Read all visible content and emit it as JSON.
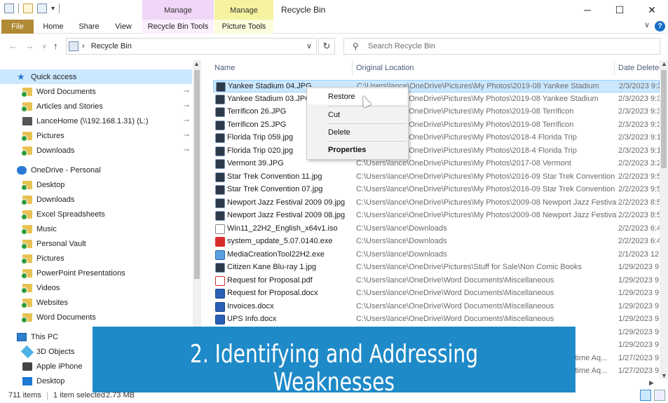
{
  "window": {
    "title": "Recycle Bin",
    "context_tab_group_1": "Manage",
    "context_tab_group_2": "Manage",
    "minimize_glyph": "─",
    "maximize_glyph": "☐",
    "close_glyph": "✕"
  },
  "ribbon": {
    "file": "File",
    "home": "Home",
    "share": "Share",
    "view": "View",
    "recycle_bin_tools": "Recycle Bin Tools",
    "picture_tools": "Picture Tools",
    "help_glyph": "?",
    "chevron_glyph": "∨"
  },
  "address": {
    "back_glyph": "←",
    "forward_glyph": "→",
    "up_glyph": "↑",
    "recent_glyph": "∨",
    "separator": "›",
    "location": "Recycle Bin",
    "dropdown_glyph": "∨",
    "refresh_glyph": "↻"
  },
  "search": {
    "icon_glyph": "⚲",
    "placeholder": "Search Recycle Bin"
  },
  "nav": {
    "items": [
      {
        "label": "Quick access",
        "icon": "star-icon",
        "pinned": false,
        "selected": true
      },
      {
        "label": "Word Documents",
        "icon": "folder-icon",
        "pinned": true
      },
      {
        "label": "Articles and Stories",
        "icon": "folder-icon",
        "pinned": true
      },
      {
        "label": "LanceHome (\\\\192.168.1.31) (L:)",
        "icon": "network-drive-icon",
        "pinned": true
      },
      {
        "label": "Pictures",
        "icon": "folder-icon",
        "pinned": true
      },
      {
        "label": "Downloads",
        "icon": "folder-icon",
        "pinned": true
      },
      {
        "label": "OneDrive - Personal",
        "icon": "cloud-icon",
        "pinned": false
      },
      {
        "label": "Desktop",
        "icon": "folder-icon",
        "pinned": false
      },
      {
        "label": "Downloads",
        "icon": "folder-icon",
        "pinned": false
      },
      {
        "label": "Excel Spreadsheets",
        "icon": "folder-icon",
        "pinned": false
      },
      {
        "label": "Music",
        "icon": "folder-icon",
        "pinned": false
      },
      {
        "label": "Personal Vault",
        "icon": "folder-icon",
        "pinned": false
      },
      {
        "label": "Pictures",
        "icon": "folder-icon",
        "pinned": false
      },
      {
        "label": "PowerPoint Presentations",
        "icon": "folder-icon",
        "pinned": false
      },
      {
        "label": "Videos",
        "icon": "folder-icon",
        "pinned": false
      },
      {
        "label": "Websites",
        "icon": "folder-icon",
        "pinned": false
      },
      {
        "label": "Word Documents",
        "icon": "folder-icon",
        "pinned": false
      },
      {
        "label": "This PC",
        "icon": "pc-icon",
        "pinned": false
      },
      {
        "label": "3D Objects",
        "icon": "cube-icon",
        "pinned": false
      },
      {
        "label": "Apple iPhone",
        "icon": "phone-icon",
        "pinned": false
      },
      {
        "label": "Desktop",
        "icon": "desktop-icon",
        "pinned": false
      }
    ],
    "pin_glyph": "📌"
  },
  "columns": {
    "name": "Name",
    "original_location": "Original Location",
    "date_deleted": "Date Deleted"
  },
  "files": [
    {
      "name": "Yankee Stadium 04.JPG",
      "location": "C:\\Users\\lance\\OneDrive\\Pictures\\My Photos\\2019-08 Yankee Stadium",
      "date": "2/3/2023 9:3",
      "type": "jpg",
      "selected": true
    },
    {
      "name": "Yankee Stadium 03.JPG",
      "location": "C:\\Users\\lance\\OneDrive\\Pictures\\My Photos\\2019-08 Yankee Stadium",
      "date": "2/3/2023 9:3",
      "type": "jpg"
    },
    {
      "name": "Terrificon 26.JPG",
      "location": "C:\\Users\\lance\\OneDrive\\Pictures\\My Photos\\2019-08 Terrificon",
      "date": "2/3/2023 9:3",
      "type": "jpg"
    },
    {
      "name": "Terrificon 25.JPG",
      "location": "C:\\Users\\lance\\OneDrive\\Pictures\\My Photos\\2019-08 Terrificon",
      "date": "2/3/2023 9:3",
      "type": "jpg"
    },
    {
      "name": "Florida Trip 059.jpg",
      "location": "C:\\Users\\lance\\OneDrive\\Pictures\\My Photos\\2018-4 Florida Trip",
      "date": "2/3/2023 9:1",
      "type": "jpg"
    },
    {
      "name": "Florida Trip 020.jpg",
      "location": "C:\\Users\\lance\\OneDrive\\Pictures\\My Photos\\2018-4 Florida Trip",
      "date": "2/3/2023 9:1",
      "type": "jpg"
    },
    {
      "name": "Vermont 39.JPG",
      "location": "C:\\Users\\lance\\OneDrive\\Pictures\\My Photos\\2017-08 Vermont",
      "date": "2/2/2023 3:2",
      "type": "jpg"
    },
    {
      "name": "Star Trek Convention 11.jpg",
      "location": "C:\\Users\\lance\\OneDrive\\Pictures\\My Photos\\2016-09 Star Trek Convention",
      "date": "2/2/2023 9:5",
      "type": "jpg"
    },
    {
      "name": "Star Trek Convention 07.jpg",
      "location": "C:\\Users\\lance\\OneDrive\\Pictures\\My Photos\\2016-09 Star Trek Convention",
      "date": "2/2/2023 9:5",
      "type": "jpg"
    },
    {
      "name": "Newport Jazz Festival 2009 09.jpg",
      "location": "C:\\Users\\lance\\OneDrive\\Pictures\\My Photos\\2009-08 Newport Jazz Festival",
      "date": "2/2/2023 8:5",
      "type": "jpg"
    },
    {
      "name": "Newport Jazz Festival 2009 08.jpg",
      "location": "C:\\Users\\lance\\OneDrive\\Pictures\\My Photos\\2009-08 Newport Jazz Festival",
      "date": "2/2/2023 8:5",
      "type": "jpg"
    },
    {
      "name": "Win11_22H2_English_x64v1.iso",
      "location": "C:\\Users\\lance\\Downloads",
      "date": "2/2/2023 6:4",
      "type": "iso"
    },
    {
      "name": "system_update_5.07.0140.exe",
      "location": "C:\\Users\\lance\\Downloads",
      "date": "2/2/2023 6:4",
      "type": "exe-red"
    },
    {
      "name": "MediaCreationTool22H2.exe",
      "location": "C:\\Users\\lance\\Downloads",
      "date": "2/1/2023 12",
      "type": "exe"
    },
    {
      "name": "Citizen Kane Blu-ray 1.jpg",
      "location": "C:\\Users\\lance\\OneDrive\\Pictures\\Stuff for Sale\\Non Comic Books",
      "date": "1/29/2023 9",
      "type": "jpg"
    },
    {
      "name": "Request for Proposal.pdf",
      "location": "C:\\Users\\lance\\OneDrive\\Word Documents\\Miscellaneous",
      "date": "1/29/2023 9",
      "type": "pdf"
    },
    {
      "name": "Request for Proposal.docx",
      "location": "C:\\Users\\lance\\OneDrive\\Word Documents\\Miscellaneous",
      "date": "1/29/2023 9",
      "type": "doc"
    },
    {
      "name": "Invoices.docx",
      "location": "C:\\Users\\lance\\OneDrive\\Word Documents\\Miscellaneous",
      "date": "1/29/2023 9",
      "type": "doc"
    },
    {
      "name": "UPS Info.docx",
      "location": "C:\\Users\\lance\\OneDrive\\Word Documents\\Miscellaneous",
      "date": "1/29/2023 9",
      "type": "doc"
    },
    {
      "name": "",
      "location": "",
      "date": "1/29/2023 9",
      "type": "doc"
    },
    {
      "name": "",
      "location": "",
      "date": "1/29/2023 9",
      "type": "doc"
    },
    {
      "name": "",
      "location": "itime Aq...",
      "date": "1/27/2023 9",
      "type": "doc"
    },
    {
      "name": "",
      "location": "itime Aq...",
      "date": "1/27/2023 9",
      "type": "doc"
    }
  ],
  "context_menu": {
    "restore": "Restore",
    "cut": "Cut",
    "delete": "Delete",
    "properties": "Properties"
  },
  "banner": {
    "line1": "2. Identifying and Addressing",
    "line2": "Weaknesses"
  },
  "status": {
    "item_count": "711 items",
    "selection": "1 item selected",
    "size": "2.73 MB"
  },
  "scroll": {
    "up_glyph": "▲",
    "down_glyph": "▼",
    "right_glyph": "▶"
  }
}
